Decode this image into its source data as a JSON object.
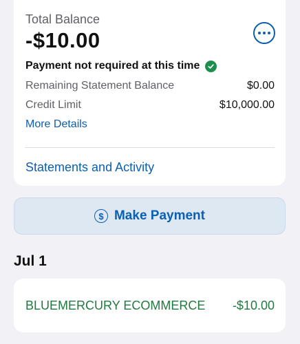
{
  "balance": {
    "label": "Total Balance",
    "amount": "-$10.00",
    "more_icon": "ellipsis-icon"
  },
  "status": {
    "text": "Payment not required at this time",
    "icon": "check-circle-icon",
    "icon_color": "#1e8e4f"
  },
  "details": [
    {
      "label": "Remaining Statement Balance",
      "value": "$0.00"
    },
    {
      "label": "Credit Limit",
      "value": "$10,000.00"
    }
  ],
  "links": {
    "more_details": "More Details",
    "statements": "Statements and Activity"
  },
  "payment_button": {
    "label": "Make Payment",
    "icon": "dollar-circle-icon"
  },
  "transactions": {
    "date": "Jul 1",
    "items": [
      {
        "merchant": "BLUEMERCURY ECOMMERCE",
        "amount": "-$10.00"
      }
    ]
  },
  "colors": {
    "accent": "#0b5fb0",
    "credit_green": "#1f7a3f",
    "background": "#f2f2f6"
  }
}
